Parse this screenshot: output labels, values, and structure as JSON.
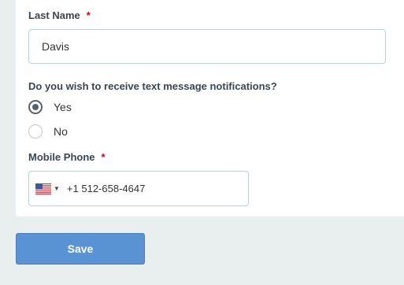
{
  "form": {
    "last_name": {
      "label": "Last Name",
      "required_mark": "*",
      "value": "Davis"
    },
    "text_notifications": {
      "question": "Do you wish to receive text message notifications?",
      "options": [
        {
          "label": "Yes",
          "selected": true
        },
        {
          "label": "No",
          "selected": false
        }
      ]
    },
    "mobile_phone": {
      "label": "Mobile Phone",
      "required_mark": "*",
      "country_flag": "us-flag-icon",
      "value": "+1 512-658-4647"
    }
  },
  "actions": {
    "save_label": "Save"
  },
  "colors": {
    "background": "#e9eeee",
    "card": "#ffffff",
    "input_border": "#b6d5d2",
    "required": "#d0021b",
    "save_button": "#5a93d3"
  }
}
